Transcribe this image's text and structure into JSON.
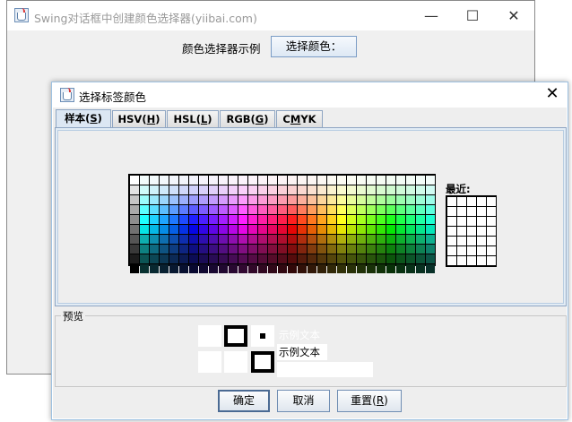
{
  "main_window": {
    "title": "Swing对话框中创建颜色选择器(yiibai.com)",
    "label": "颜色选择器示例",
    "button_label": "选择颜色：",
    "caption": {
      "minimize": "—",
      "maximize": "☐",
      "close": "✕"
    }
  },
  "dialog": {
    "title": "选择标签颜色",
    "close_glyph": "✕",
    "tabs": [
      {
        "label": "样本(S)",
        "pre": "样本(",
        "mnemonic": "S",
        "post": ")",
        "active": true
      },
      {
        "label": "HSV(H)",
        "pre": "HSV(",
        "mnemonic": "H",
        "post": ")",
        "active": false
      },
      {
        "label": "HSL(L)",
        "pre": "HSL(",
        "mnemonic": "L",
        "post": ")",
        "active": false
      },
      {
        "label": "RGB(G)",
        "pre": "RGB(",
        "mnemonic": "G",
        "post": ")",
        "active": false
      },
      {
        "label": "CMYK",
        "pre": "C",
        "mnemonic": "M",
        "post": "YK",
        "active": false
      }
    ],
    "recent_label": "最近:",
    "preview_label": "预览",
    "sample_text": "示例文本",
    "buttons": {
      "ok": "确定",
      "cancel": "取消",
      "reset_pre": "重置(",
      "reset_mnemonic": "R",
      "reset_post": ")"
    }
  },
  "swatches": {
    "columns": 31,
    "rows": 10,
    "recent_columns": 5,
    "recent_rows": 7
  }
}
